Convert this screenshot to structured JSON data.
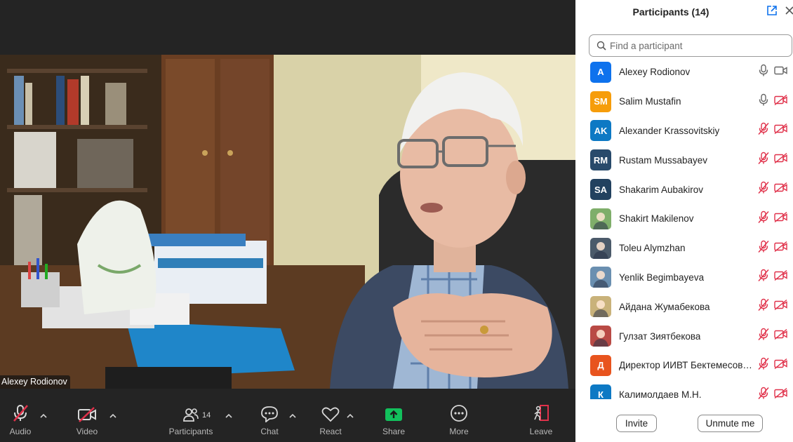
{
  "video": {
    "speaker_name": "Alexey Rodionov"
  },
  "toolbar": {
    "audio_label": "Audio",
    "video_label": "Video",
    "participants_label": "Participants",
    "participants_count": "14",
    "chat_label": "Chat",
    "react_label": "React",
    "share_label": "Share",
    "more_label": "More",
    "leave_label": "Leave",
    "share_color": "#12c05c",
    "muted_color": "#e0314a"
  },
  "panel": {
    "title": "Participants (14)",
    "search_placeholder": "Find a participant",
    "invite_label": "Invite",
    "unmute_label": "Unmute me",
    "participants": [
      {
        "initials": "A",
        "name": "Alexey Rodionov",
        "avatar_color": "#0e72ed",
        "mic": "on",
        "video": "on"
      },
      {
        "initials": "SM",
        "name": "Salim Mustafin",
        "avatar_color": "#f69d0b",
        "mic": "on",
        "video": "off"
      },
      {
        "initials": "AK",
        "name": "Alexander Krassovitskiy",
        "avatar_color": "#0d79c4",
        "mic": "off",
        "video": "off"
      },
      {
        "initials": "RM",
        "name": "Rustam Mussabayev",
        "avatar_color": "#284a6b",
        "mic": "off",
        "video": "off"
      },
      {
        "initials": "SA",
        "name": "Shakarim Aubakirov",
        "avatar_color": "#22415f",
        "mic": "off",
        "video": "off"
      },
      {
        "initials": "",
        "name": "Shakirt Makilenov",
        "avatar_color": "#7fae6a",
        "mic": "off",
        "video": "off"
      },
      {
        "initials": "",
        "name": "Toleu Alymzhan",
        "avatar_color": "#4b5a6a",
        "mic": "off",
        "video": "off"
      },
      {
        "initials": "",
        "name": "Yenlik Begimbayeva",
        "avatar_color": "#6a8fb0",
        "mic": "off",
        "video": "off"
      },
      {
        "initials": "",
        "name": "Айдана Жумабекова",
        "avatar_color": "#c9b27a",
        "mic": "off",
        "video": "off"
      },
      {
        "initials": "",
        "name": "Гулзат Зиятбекова",
        "avatar_color": "#b94a45",
        "mic": "off",
        "video": "off"
      },
      {
        "initials": "Д",
        "name": "Директор ИИВТ Бектемесов ...",
        "avatar_color": "#e8541e",
        "mic": "off",
        "video": "off"
      },
      {
        "initials": "К",
        "name": "Калимолдаев М.Н.",
        "avatar_color": "#0d79c4",
        "mic": "off",
        "video": "off"
      }
    ]
  }
}
